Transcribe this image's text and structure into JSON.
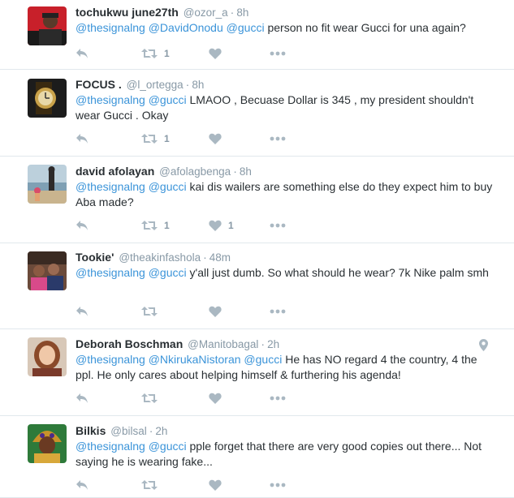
{
  "tweets": [
    {
      "name": "tochukwu june27th",
      "handle": "@ozor_a",
      "separator": "·",
      "time": "8h",
      "mentions": [
        "@thesignalng",
        "@DavidOnodu",
        "@gucci"
      ],
      "body": "person no fit wear Gucci for una again?",
      "retweet_count": "1",
      "like_count": "",
      "avatar_icon": "avatar-person-red-background"
    },
    {
      "name": "FOCUS .",
      "handle": "@l_ortegga",
      "separator": "·",
      "time": "8h",
      "mentions": [
        "@thesignalng",
        "@gucci"
      ],
      "body": "LMAOO , Becuase Dollar is 345 , my president shouldn't wear Gucci . Okay",
      "retweet_count": "1",
      "like_count": "",
      "avatar_icon": "avatar-gold-watch"
    },
    {
      "name": "david afolayan",
      "handle": "@afolagbenga",
      "separator": "·",
      "time": "8h",
      "mentions": [
        "@thesignalng",
        "@gucci"
      ],
      "body": "kai dis wailers are something else do they expect him to buy Aba made?",
      "retweet_count": "1",
      "like_count": "1",
      "avatar_icon": "avatar-beach-photo"
    },
    {
      "name": "Tookie'",
      "handle": "@theakinfashola",
      "separator": "·",
      "time": "48m",
      "mentions": [
        "@thesignalng",
        "@gucci"
      ],
      "body": "y'all just dumb. So what should he wear? 7k Nike palm smh",
      "retweet_count": "",
      "like_count": "",
      "avatar_icon": "avatar-group-photo"
    },
    {
      "name": "Deborah Boschman",
      "handle": "@Manitobagal",
      "separator": "·",
      "time": "2h",
      "mentions": [
        "@thesignalng",
        "@NkirukaNistoran",
        "@gucci"
      ],
      "body": "He has NO regard 4 the country, 4 the ppl. He only cares about helping himself & furthering his agenda!",
      "retweet_count": "",
      "like_count": "",
      "avatar_icon": "avatar-woman-portrait",
      "has_location": true
    },
    {
      "name": "Bilkis",
      "handle": "@bilsal",
      "separator": "·",
      "time": "2h",
      "mentions": [
        "@thesignalng",
        "@gucci"
      ],
      "body": "pple forget that there are very good copies out there... Not saying he is wearing fake...",
      "retweet_count": "",
      "like_count": "",
      "avatar_icon": "avatar-woman-headwrap"
    }
  ],
  "icons": {
    "reply": "reply-icon",
    "retweet": "retweet-icon",
    "like": "heart-icon",
    "more": "more-icon",
    "location": "location-pin-icon"
  },
  "colors": {
    "mention": "#3b94d9",
    "muted": "#8899a6",
    "icon": "#aab8c2",
    "divider": "#e1e8ed",
    "text": "#292f33"
  }
}
